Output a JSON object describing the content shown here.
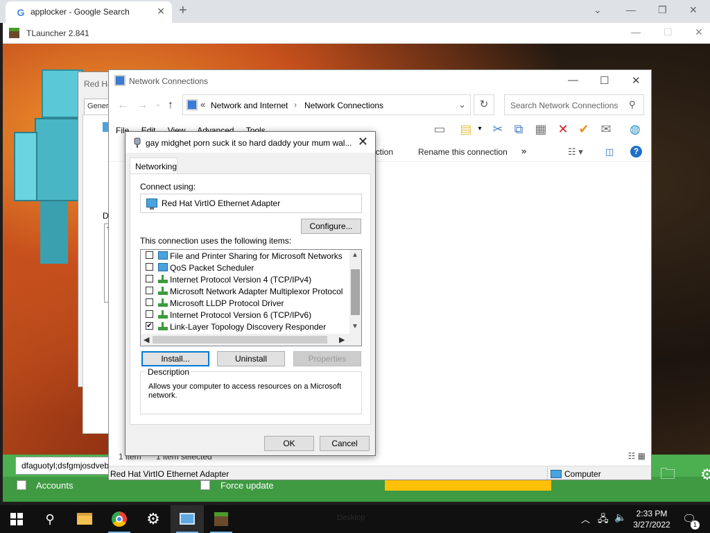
{
  "chrome": {
    "tab_title": "applocker - Google Search",
    "tab_close": "✕",
    "new_tab": "+",
    "btn_tabsearch": "⌄",
    "btn_min": "—",
    "btn_restore": "❐",
    "btn_close": "✕"
  },
  "tlauncher": {
    "title": "TLauncher 2.841",
    "username": "dfaguotyl;dsfgmjosdvebsaeiu",
    "accounts_label": "Accounts",
    "force_update_label": "Force update"
  },
  "redhat_window": {
    "title": "Red Ha",
    "tab": "Gener",
    "de_label": "De",
    "th_text": "Th"
  },
  "network_connections": {
    "title": "Network Connections",
    "breadcrumb_prefix": "«",
    "breadcrumb_1": "Network and Internet",
    "breadcrumb_sep": "›",
    "breadcrumb_2": "Network Connections",
    "search_placeholder": "Search Network Connections",
    "menu": [
      "File",
      "Edit",
      "View",
      "Advanced",
      "Tools"
    ],
    "cmd_partial": "ection",
    "cmd_rename": "Rename this connection",
    "cmd_more": "»",
    "status_count": "1 item",
    "status_selected": "1 item selected",
    "detail_adapter": "Red Hat VirtIO Ethernet Adapter",
    "detail_computer": "Computer"
  },
  "dialog": {
    "title": "gay midghet porn suck it so hard daddy your mum wal...",
    "tab": "Networking",
    "connect_using": "Connect using:",
    "adapter": "Red Hat VirtIO Ethernet Adapter",
    "configure": "Configure...",
    "items_label": "This connection uses the following items:",
    "items": [
      {
        "label": "File and Printer Sharing for Microsoft Networks",
        "checked": false,
        "icon": "network-service-icon"
      },
      {
        "label": "QoS Packet Scheduler",
        "checked": false,
        "icon": "network-service-icon"
      },
      {
        "label": "Internet Protocol Version 4 (TCP/IPv4)",
        "checked": false,
        "icon": "protocol-icon"
      },
      {
        "label": "Microsoft Network Adapter Multiplexor Protocol",
        "checked": false,
        "icon": "protocol-icon"
      },
      {
        "label": "Microsoft LLDP Protocol Driver",
        "checked": false,
        "icon": "protocol-icon"
      },
      {
        "label": "Internet Protocol Version 6 (TCP/IPv6)",
        "checked": false,
        "icon": "protocol-icon"
      },
      {
        "label": "Link-Layer Topology Discovery Responder",
        "checked": true,
        "icon": "protocol-icon"
      }
    ],
    "install": "Install...",
    "uninstall": "Uninstall",
    "properties": "Properties",
    "description_legend": "Description",
    "description_text": "Allows your computer to access resources on a Microsoft network.",
    "ok": "OK",
    "cancel": "Cancel"
  },
  "taskbar": {
    "time": "2:33 PM",
    "date": "3/27/2022",
    "notifications": "1",
    "desktop_ghost": "Desktop"
  }
}
